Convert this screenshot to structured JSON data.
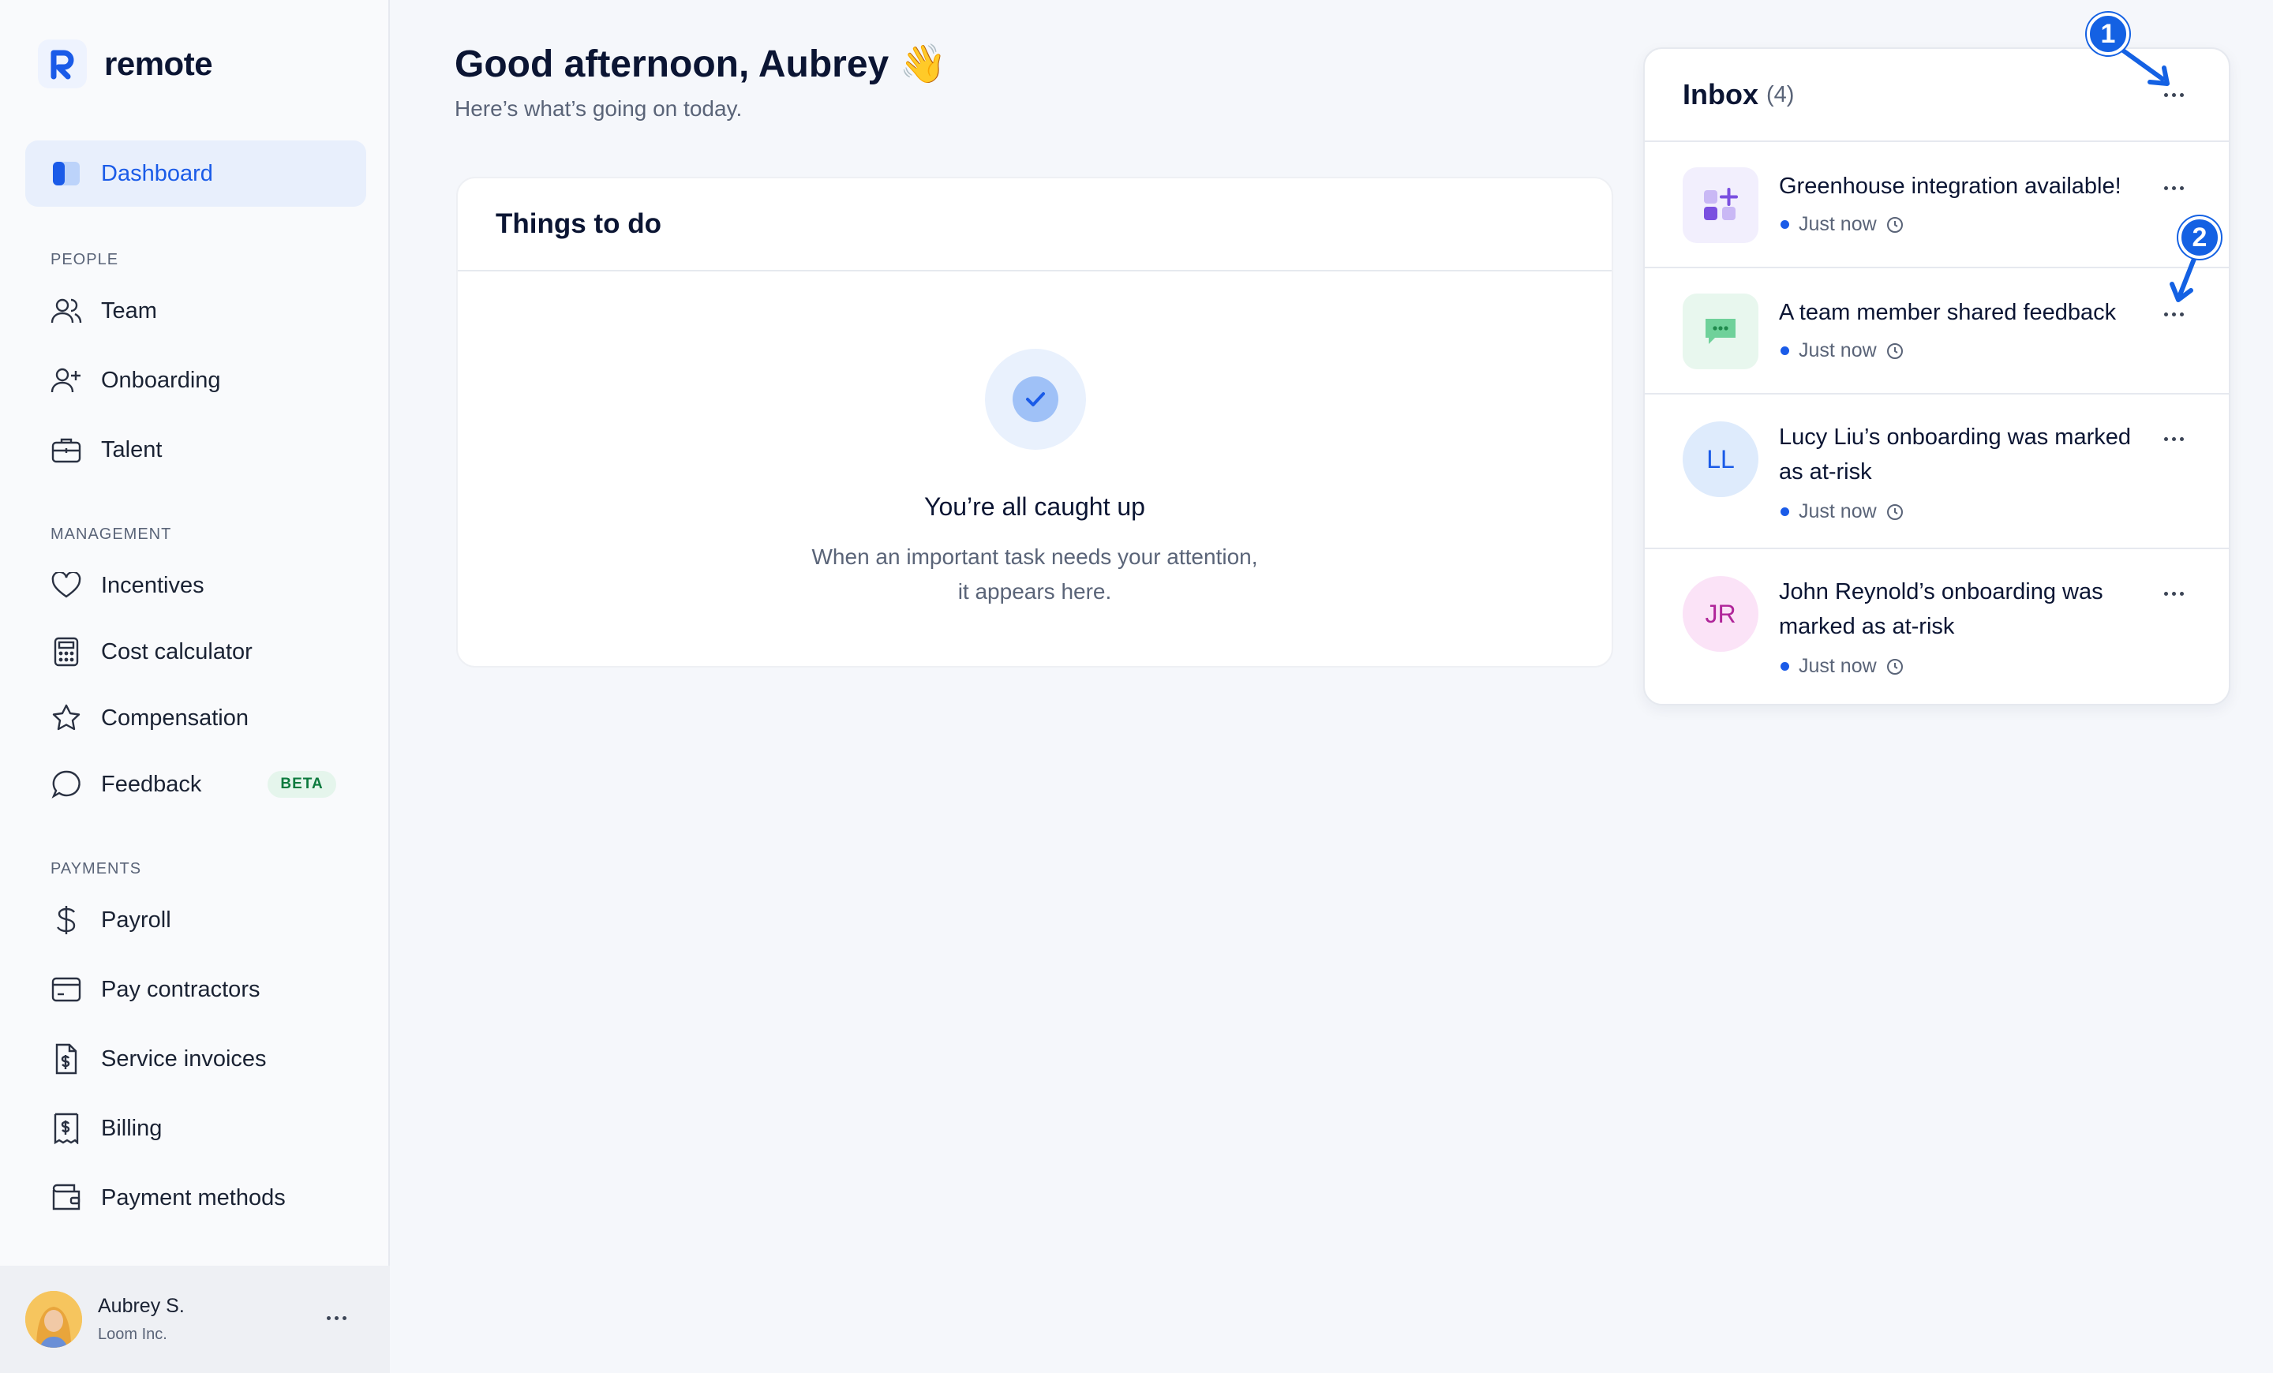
{
  "brand": {
    "name": "remote"
  },
  "sidebar": {
    "dashboard": "Dashboard",
    "sections": {
      "people": "PEOPLE",
      "management": "MANAGEMENT",
      "payments": "PAYMENTS"
    },
    "people_items": [
      "Team",
      "Onboarding",
      "Talent"
    ],
    "management_items": [
      "Incentives",
      "Cost calculator",
      "Compensation",
      "Feedback"
    ],
    "feedback_badge": "BETA",
    "payments_items": [
      "Payroll",
      "Pay contractors",
      "Service invoices",
      "Billing",
      "Payment methods"
    ]
  },
  "user": {
    "name": "Aubrey S.",
    "company": "Loom Inc."
  },
  "header": {
    "greeting": "Good afternoon, Aubrey 👋",
    "subtitle": "Here’s what’s going on today."
  },
  "todo": {
    "title": "Things to do",
    "empty_title": "You’re all caught up",
    "empty_line1": "When an important task needs your attention,",
    "empty_line2": "it appears here."
  },
  "inbox": {
    "title": "Inbox",
    "count": "(4)",
    "items": [
      {
        "text": "Greenhouse integration available!",
        "time": "Just now",
        "icon": "apps-plus-icon"
      },
      {
        "text": "A team member shared feedback",
        "time": "Just now",
        "icon": "chat-bubble-icon"
      },
      {
        "line1": "Lucy Liu’s onboarding was marked",
        "line2": "as at-risk",
        "time": "Just now",
        "initials": "LL"
      },
      {
        "line1": "John Reynold’s onboarding was",
        "line2": "marked as at-risk",
        "time": "Just now",
        "initials": "JR"
      }
    ]
  },
  "annotations": {
    "one": "1",
    "two": "2"
  },
  "colors": {
    "accent": "#1a5be8",
    "annotation": "#1461e3",
    "beta_bg": "#e5f5ec",
    "beta_text": "#0d7a3e"
  }
}
